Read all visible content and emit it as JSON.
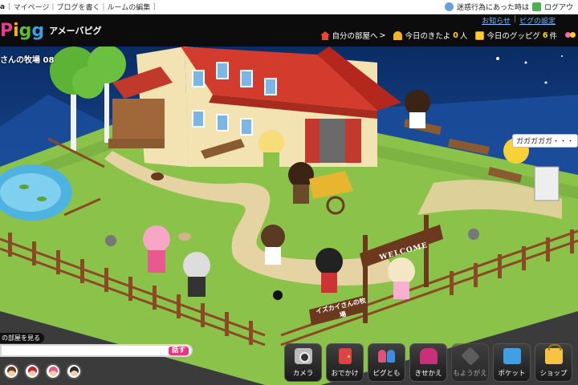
{
  "topbar": {
    "brand": "a",
    "links": [
      "マイページ",
      "ブログを書く",
      "ルームの編集"
    ],
    "report_text": "迷惑行為にあった時は",
    "logout": "ログアウ"
  },
  "header": {
    "logo_letters": [
      "P",
      "i",
      "g",
      "g"
    ],
    "logo_sub": "アメーバピグ",
    "links": [
      "お知らせ",
      "ピグの設定"
    ],
    "my_room_label": "自分の部屋へ",
    "visitors_label": "今日のきたよ",
    "visitors_count": "0",
    "visitors_unit": "人",
    "gupigu_label": "今日のグッピグ",
    "gupigu_count": "6",
    "gupigu_unit": "件"
  },
  "scene": {
    "room_title": "さんの牧場 08",
    "speech_bubble": "ガガガガガ・・・",
    "welcome_sign": "WELCOME",
    "farm_sign": "イズカイさんの牧場"
  },
  "chat": {
    "see_room_label": "の部屋を見る",
    "input_value": "",
    "talk_button": "話す",
    "avatars": [
      "avatar-1",
      "avatar-2",
      "avatar-3",
      "avatar-4"
    ]
  },
  "toolbar": [
    {
      "label": "カメラ",
      "icon": "camera-icon"
    },
    {
      "label": "おでかけ",
      "icon": "door-icon"
    },
    {
      "label": "ピグとも",
      "icon": "friends-icon"
    },
    {
      "label": "きせかえ",
      "icon": "dressup-icon"
    },
    {
      "label": "もようがえ",
      "icon": "room-decor-icon",
      "disabled": true
    },
    {
      "label": "ポケット",
      "icon": "pocket-icon"
    },
    {
      "label": "ショップ",
      "icon": "shop-icon"
    }
  ],
  "colors": {
    "header_bg": "#0c0c0c",
    "accent_pink": "#e8377d",
    "grass": "#8bc34a",
    "sky": "#0f3a7c"
  }
}
